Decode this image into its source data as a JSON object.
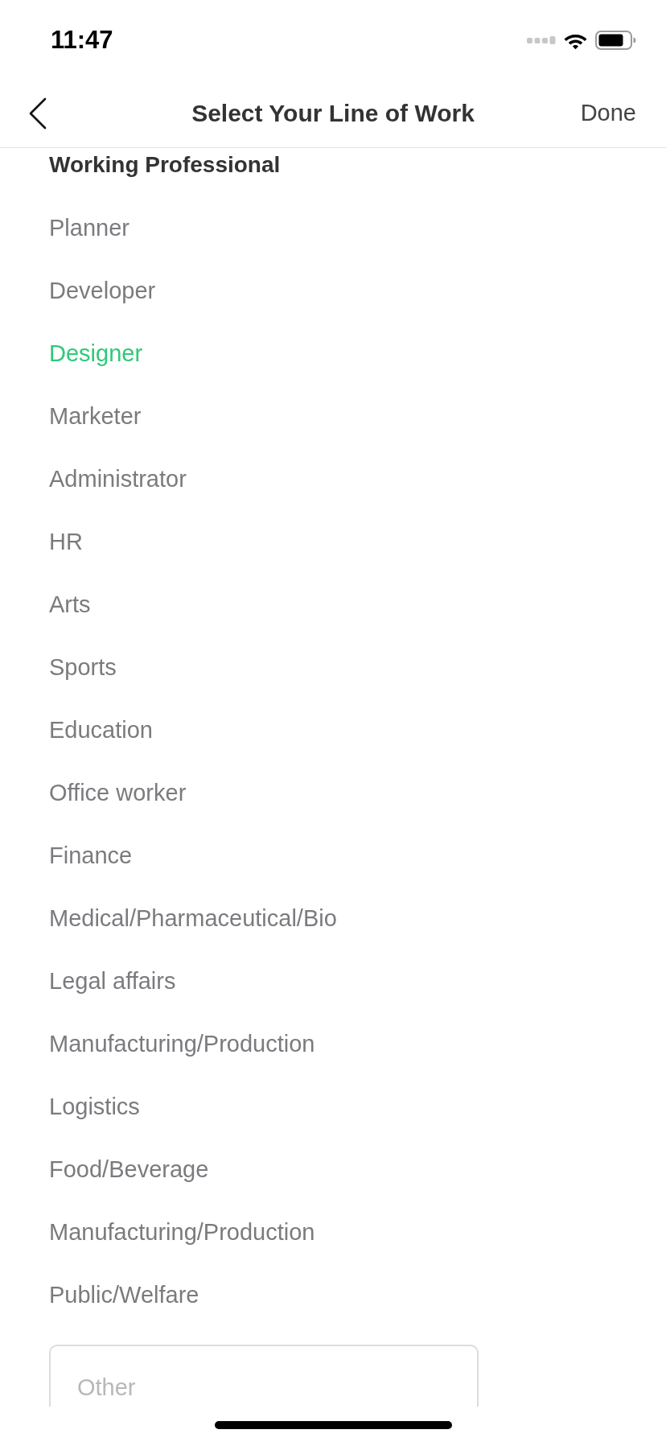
{
  "status_bar": {
    "time": "11:47"
  },
  "nav": {
    "title": "Select Your Line of Work",
    "done": "Done"
  },
  "section": {
    "title": "Working Professional",
    "items": [
      {
        "label": "Planner",
        "selected": false
      },
      {
        "label": "Developer",
        "selected": false
      },
      {
        "label": "Designer",
        "selected": true
      },
      {
        "label": "Marketer",
        "selected": false
      },
      {
        "label": "Administrator",
        "selected": false
      },
      {
        "label": "HR",
        "selected": false
      },
      {
        "label": "Arts",
        "selected": false
      },
      {
        "label": "Sports",
        "selected": false
      },
      {
        "label": "Education",
        "selected": false
      },
      {
        "label": "Office worker",
        "selected": false
      },
      {
        "label": "Finance",
        "selected": false
      },
      {
        "label": "Medical/Pharmaceutical/Bio",
        "selected": false
      },
      {
        "label": "Legal affairs",
        "selected": false
      },
      {
        "label": "Manufacturing/Production",
        "selected": false
      },
      {
        "label": "Logistics",
        "selected": false
      },
      {
        "label": "Food/Beverage",
        "selected": false
      },
      {
        "label": "Manufacturing/Production",
        "selected": false
      },
      {
        "label": "Public/Welfare",
        "selected": false
      }
    ]
  },
  "other_field": {
    "placeholder": "Other"
  }
}
